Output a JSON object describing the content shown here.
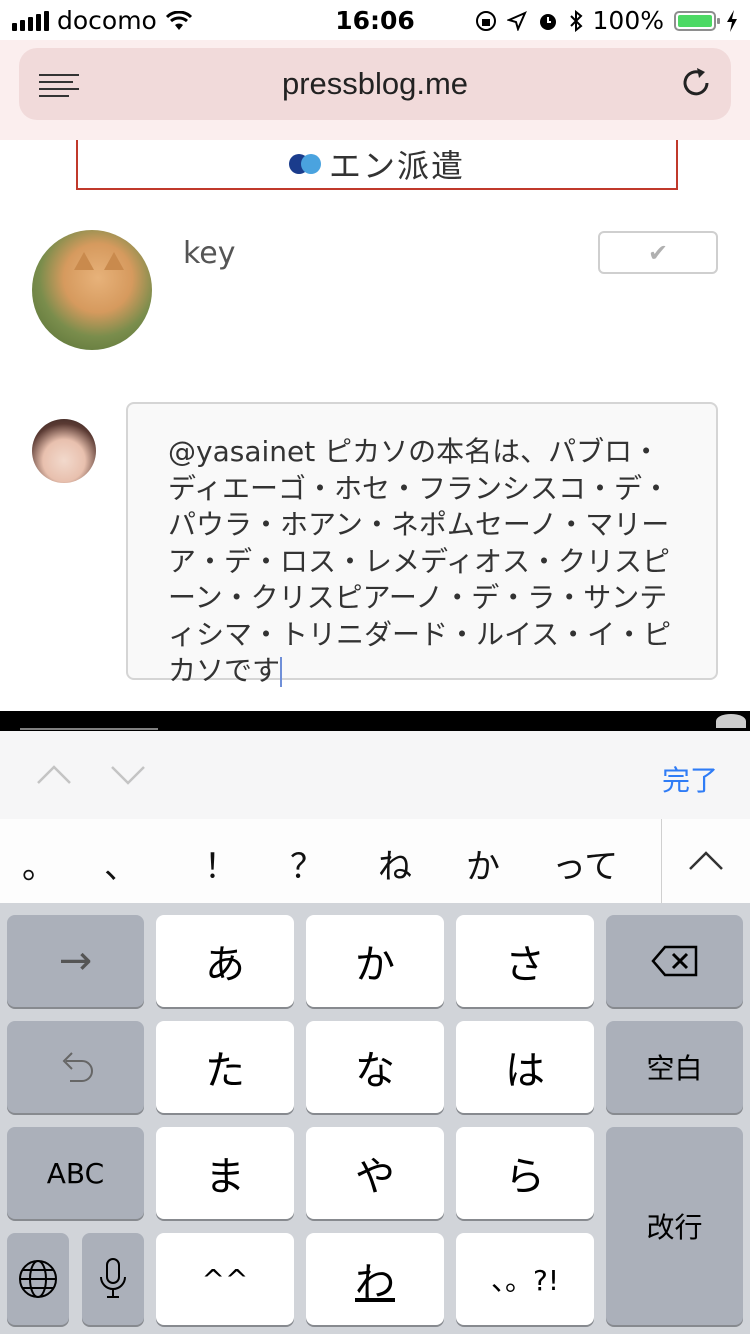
{
  "status_bar": {
    "carrier": "docomo",
    "time": "16:06",
    "battery_percent": "100%",
    "battery_color": "#4cd964"
  },
  "browser": {
    "url": "pressblog.me",
    "menu_icon": "reader-menu-icon",
    "reload_icon": "reload-icon"
  },
  "banner": {
    "text": "エン派遣",
    "logo_colors": [
      "#1a3c8c",
      "#4aa3df"
    ]
  },
  "post": {
    "username": "key",
    "check_label": "✔"
  },
  "comment": {
    "text": "@yasainet ピカソの本名は、パブロ・ディエーゴ・ホセ・フランシスコ・デ・パウラ・ホアン・ネポムセーノ・マリーア・デ・ロス・レメディオス・クリスピーン・クリスピアーノ・デ・ラ・サンティシマ・トリニダード・ルイス・イ・ピカソです"
  },
  "accessory_bar": {
    "done_label": "完了",
    "done_color": "#2f7cf6"
  },
  "candidates": [
    "。",
    "、",
    "！",
    "？",
    "ね",
    "か",
    "って"
  ],
  "keyboard": {
    "rows": [
      [
        "→",
        "あ",
        "か",
        "さ",
        "⌫"
      ],
      [
        "↺",
        "た",
        "な",
        "は",
        "空白"
      ],
      [
        "ABC",
        "ま",
        "や",
        "ら",
        "改行"
      ],
      [
        "🌐",
        "🎤",
        "^^",
        "わ",
        "、。?!"
      ]
    ],
    "keys": {
      "arrow": "→",
      "a": "あ",
      "ka": "か",
      "sa": "さ",
      "ta": "た",
      "na": "な",
      "ha": "は",
      "space": "空白",
      "abc": "ABC",
      "ma": "ま",
      "ya": "や",
      "ra": "ら",
      "return": "改行",
      "kaomoji": "^^",
      "wa": "わ",
      "punct": "、。?!"
    }
  }
}
